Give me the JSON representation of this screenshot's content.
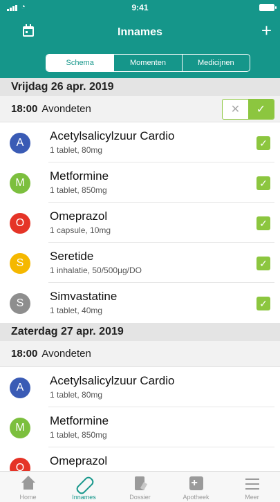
{
  "status_bar": {
    "time": "9:41"
  },
  "nav": {
    "title": "Innames",
    "add_label": "+"
  },
  "segments": [
    {
      "label": "Schema",
      "active": true
    },
    {
      "label": "Momenten",
      "active": false
    },
    {
      "label": "Medicijnen",
      "active": false
    }
  ],
  "days": [
    {
      "date": "Vrijdag 26 apr. 2019",
      "moment_time": "18:00",
      "moment_label": "Avondeten",
      "toggle": {
        "reject": "✕",
        "confirm": "✓"
      },
      "meds": [
        {
          "letter": "A",
          "color": "#3a5bb5",
          "name": "Acetylsalicylzuur Cardio",
          "dose": "1 tablet, 80mg",
          "checked": true
        },
        {
          "letter": "M",
          "color": "#7cbf3e",
          "name": "Metformine",
          "dose": "1 tablet, 850mg",
          "checked": true
        },
        {
          "letter": "O",
          "color": "#e53427",
          "name": "Omeprazol",
          "dose": "1 capsule, 10mg",
          "checked": true
        },
        {
          "letter": "S",
          "color": "#f5b800",
          "name": "Seretide",
          "dose": "1 inhalatie, 50/500µg/DO",
          "checked": true
        },
        {
          "letter": "S",
          "color": "#8e8e8e",
          "name": "Simvastatine",
          "dose": "1 tablet, 40mg",
          "checked": true
        }
      ]
    },
    {
      "date": "Zaterdag 27 apr. 2019",
      "moment_time": "18:00",
      "moment_label": "Avondeten",
      "meds": [
        {
          "letter": "A",
          "color": "#3a5bb5",
          "name": "Acetylsalicylzuur Cardio",
          "dose": "1 tablet, 80mg",
          "checked": false
        },
        {
          "letter": "M",
          "color": "#7cbf3e",
          "name": "Metformine",
          "dose": "1 tablet, 850mg",
          "checked": false
        },
        {
          "letter": "O",
          "color": "#e53427",
          "name": "Omeprazol",
          "dose": "",
          "checked": false
        }
      ]
    }
  ],
  "check_mark": "✓",
  "tabs": [
    {
      "label": "Home",
      "icon": "home-icon",
      "active": false
    },
    {
      "label": "Innames",
      "icon": "pill-icon",
      "active": true
    },
    {
      "label": "Dossier",
      "icon": "dossier-icon",
      "active": false
    },
    {
      "label": "Apotheek",
      "icon": "pharmacy-icon",
      "active": false
    },
    {
      "label": "Meer",
      "icon": "menu-icon",
      "active": false
    }
  ],
  "colors": {
    "brand": "#15968a",
    "check": "#8cc63f"
  }
}
